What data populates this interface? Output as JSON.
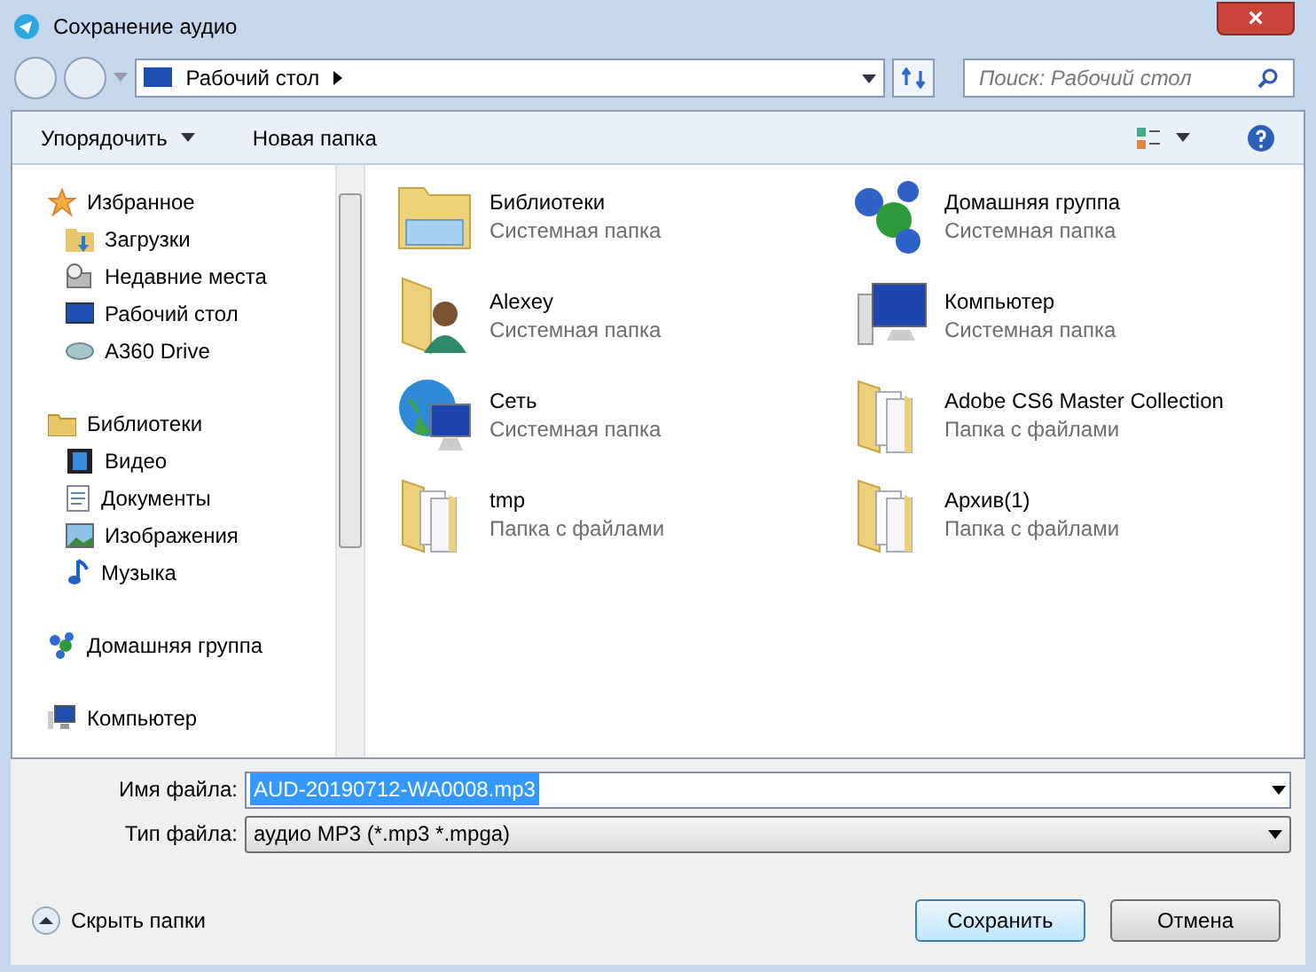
{
  "window": {
    "title": "Сохранение аудио",
    "close": "×"
  },
  "address": {
    "path": "Рабочий стол",
    "search_placeholder": "Поиск: Рабочий стол"
  },
  "toolbar": {
    "organize": "Упорядочить",
    "new_folder": "Новая папка"
  },
  "sidebar": {
    "groups": [
      {
        "label": "Избранное",
        "children": [
          {
            "label": "Загрузки"
          },
          {
            "label": "Недавние места"
          },
          {
            "label": "Рабочий стол"
          },
          {
            "label": "A360 Drive"
          }
        ]
      },
      {
        "label": "Библиотеки",
        "children": [
          {
            "label": "Видео"
          },
          {
            "label": "Документы"
          },
          {
            "label": "Изображения"
          },
          {
            "label": "Музыка"
          }
        ]
      },
      {
        "label": "Домашняя группа"
      },
      {
        "label": "Компьютер"
      }
    ]
  },
  "items": [
    {
      "name": "Библиотеки",
      "type": "Системная папка",
      "kind": "library"
    },
    {
      "name": "Домашняя группа",
      "type": "Системная папка",
      "kind": "homegroup"
    },
    {
      "name": "Alexey",
      "type": "Системная папка",
      "kind": "user"
    },
    {
      "name": "Компьютер",
      "type": "Системная папка",
      "kind": "computer"
    },
    {
      "name": "Сеть",
      "type": "Системная папка",
      "kind": "network"
    },
    {
      "name": "Adobe CS6 Master Collection",
      "type": "Папка с файлами",
      "kind": "folder"
    },
    {
      "name": "tmp",
      "type": "Папка с файлами",
      "kind": "folder"
    },
    {
      "name": "Архив(1)",
      "type": "Папка с файлами",
      "kind": "folder"
    }
  ],
  "file_name": {
    "label": "Имя файла:",
    "value": "AUD-20190712-WA0008.mp3",
    "text_selected": true
  },
  "file_type": {
    "label": "Тип файла:",
    "value": "аудио MP3 (*.mp3 *.mpga)"
  },
  "hide_folders": "Скрыть папки",
  "buttons": [
    {
      "label": "Сохранить",
      "default": true
    },
    {
      "label": "Отмена",
      "default": false
    }
  ]
}
